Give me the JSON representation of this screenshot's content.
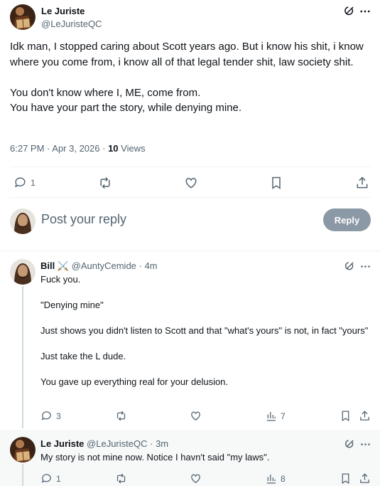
{
  "main_tweet": {
    "author_name": "Le Juriste",
    "author_handle": "@LeJuristeQC",
    "text": "Idk man, I stopped caring about Scott years ago. But i know his shit, i know where you come from, i know all of that legal tender shit, law society shit.\n\nYou don't know where I, ME, come from.\nYou have your part the story, while denying mine.",
    "time": "6:27 PM",
    "date": "Apr 3, 2026",
    "views_count": "10",
    "views_label": "Views",
    "reply_count": "1"
  },
  "compose": {
    "placeholder": "Post your reply",
    "button_label": "Reply"
  },
  "replies": [
    {
      "author_name": "Bill",
      "badge": "⚔️",
      "author_handle": "@AuntyCemide",
      "age": "4m",
      "text": "Fuck you.\n\n\"Denying mine\"\n\nJust shows you didn't listen to Scott and that \"what's yours\" is not, in fact \"yours\"\n\nJust take the L dude.\n\nYou gave up everything real for your delusion.",
      "reply_count": "3",
      "views_count": "7"
    },
    {
      "author_name": "Le Juriste",
      "author_handle": "@LeJuristeQC",
      "age": "3m",
      "text": "My story is not mine now. Notice I havn't said \"my laws\".",
      "reply_count": "1",
      "views_count": "8"
    }
  ],
  "colors": {
    "text": "#0f1419",
    "secondary": "#536471",
    "divider": "#eff3f4",
    "reply_button_disabled": "#8b98a5",
    "highlight_bg": "#f7f9f9"
  },
  "icons": [
    "grok-icon",
    "more-icon",
    "reply-icon",
    "retweet-icon",
    "like-icon",
    "bookmark-icon",
    "share-icon",
    "views-icon"
  ]
}
